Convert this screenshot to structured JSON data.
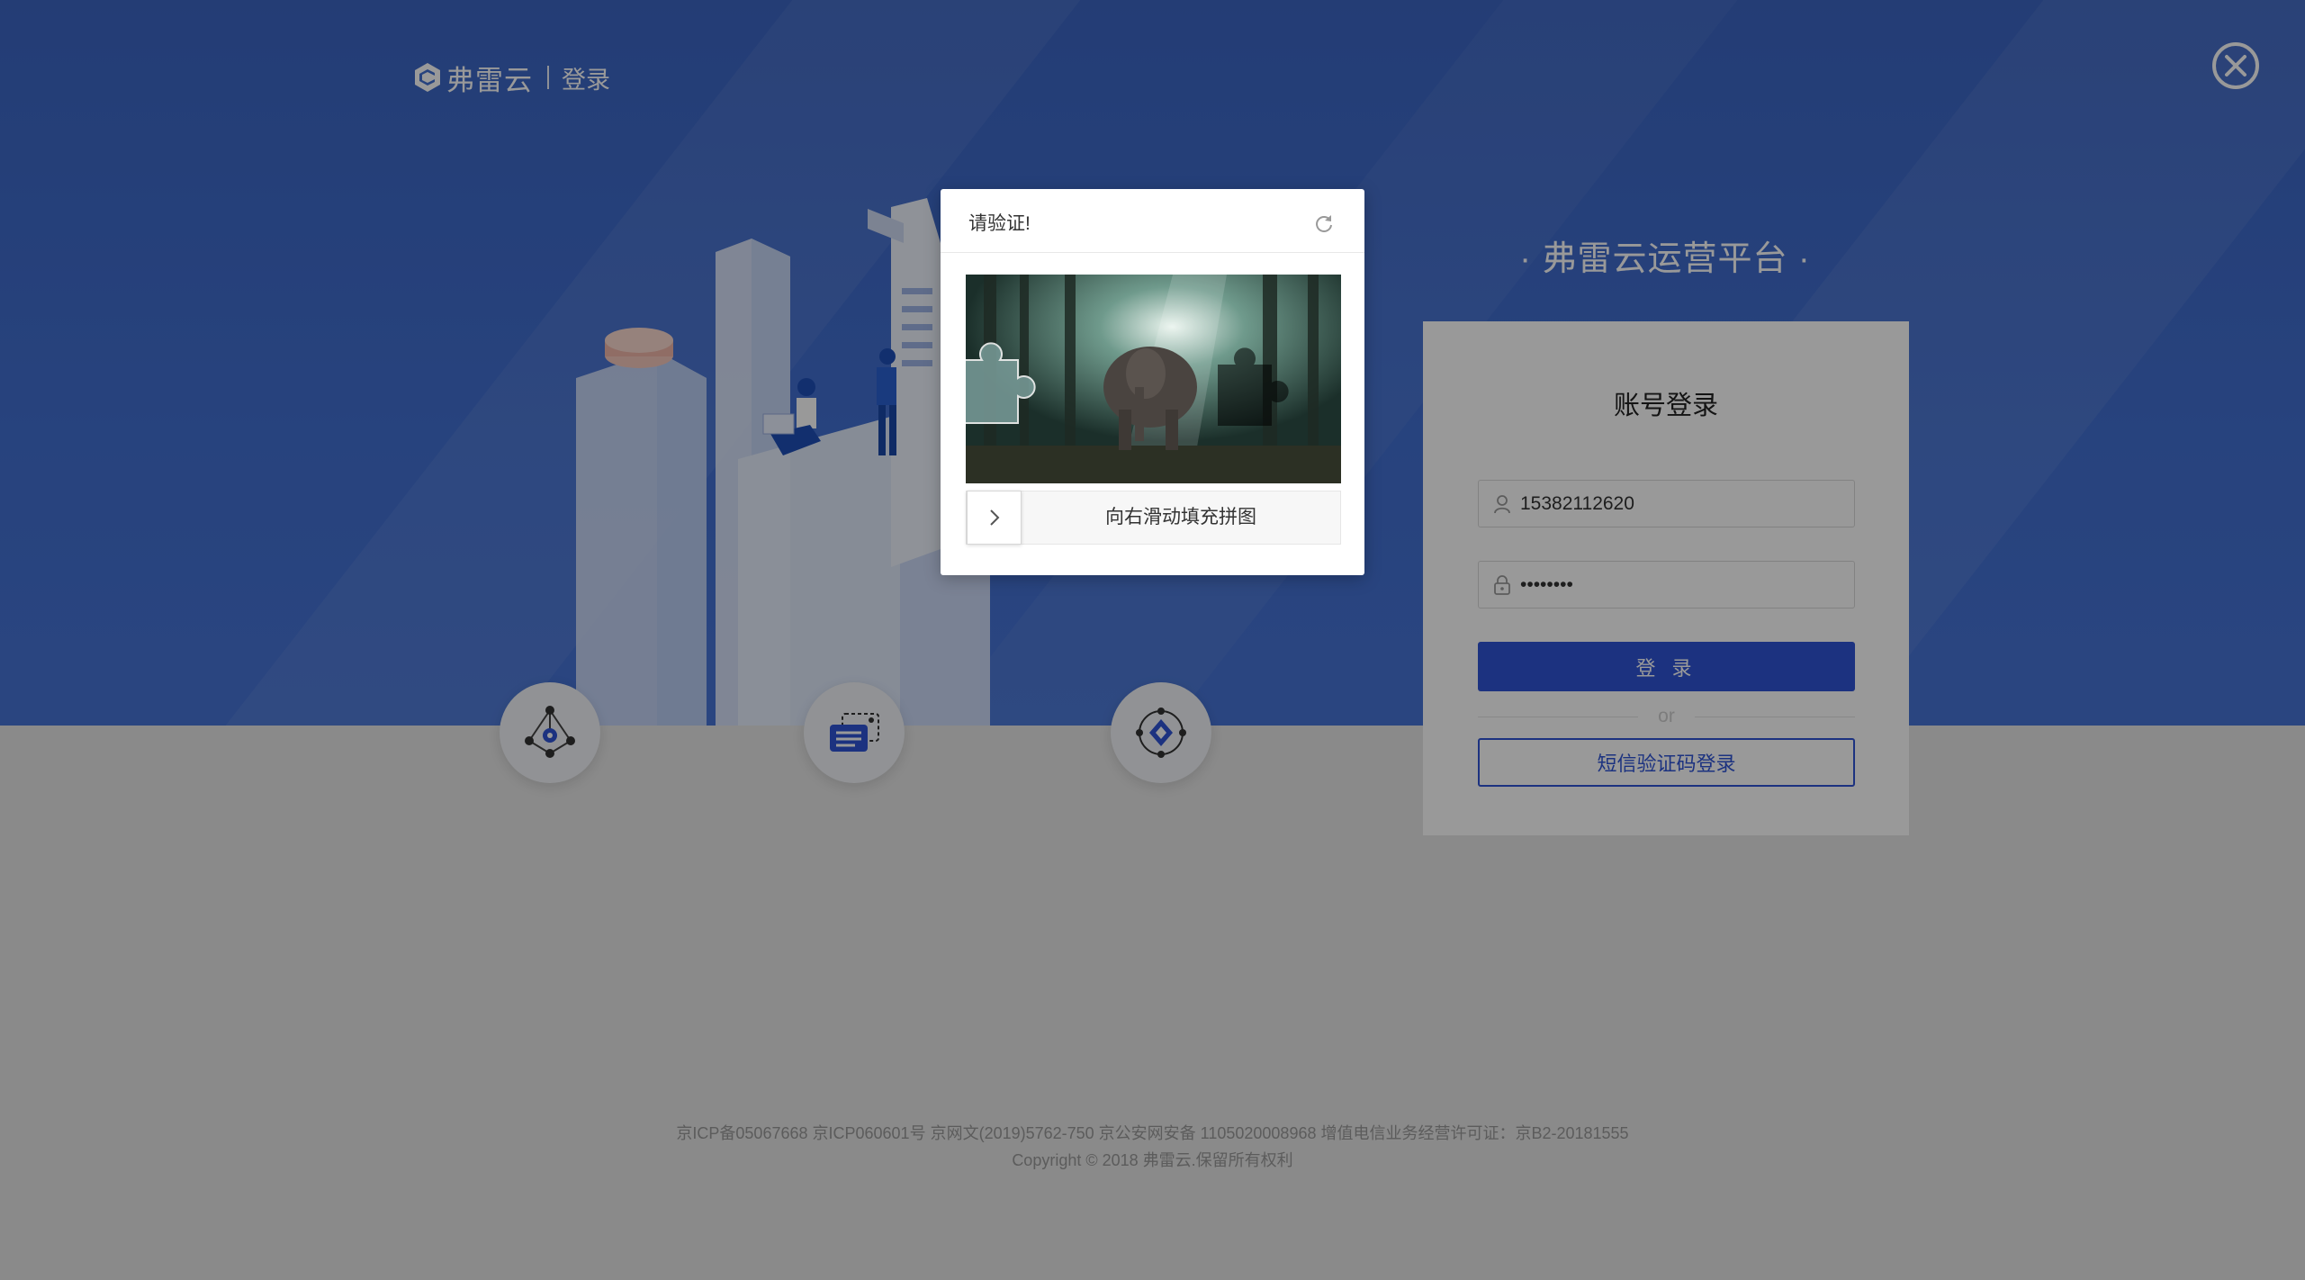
{
  "header": {
    "brand": "弗雷云",
    "page": "登录"
  },
  "platform_title": "· 弗雷云运营平台 ·",
  "login": {
    "title": "账号登录",
    "username_value": "15382112620",
    "password_value": "••••••••",
    "submit_label": "登 录",
    "or_label": "or",
    "sms_label": "短信验证码登录"
  },
  "captcha": {
    "title": "请验证!",
    "slider_hint": "向右滑动填充拼图"
  },
  "footer": {
    "license": "京ICP备05067668 京ICP060601号 京网文(2019)5762-750 京公安网安备 1105020008968 增值电信业务经营许可证：京B2-20181555",
    "copyright": "Copyright © 2018 弗雷云.保留所有权利"
  },
  "features": [
    {
      "icon": "network-node-icon"
    },
    {
      "icon": "document-stack-icon"
    },
    {
      "icon": "target-diamond-icon"
    }
  ],
  "colors": {
    "primary": "#2f54d5",
    "hero": "#4270d2"
  }
}
